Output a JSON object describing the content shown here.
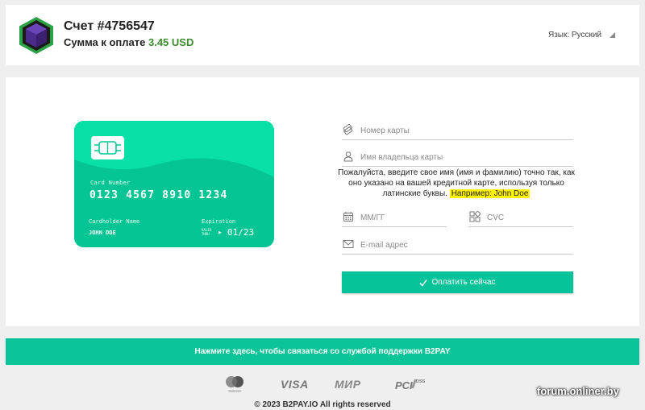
{
  "header": {
    "invoice_title": "Счет #4756547",
    "amount_label": "Сумма к оплате",
    "amount_value": "3.45 USD",
    "language": "Язык: Русский"
  },
  "card": {
    "number_label": "Card Number",
    "number": "0123 4567 8910 1234",
    "holder_label": "Cardholder Name",
    "holder_name": "JOHN DOE",
    "expiration_label": "Expiration",
    "valid_thru": "VALID THRU",
    "expiration": "01/23"
  },
  "form": {
    "card_number_placeholder": "Номер карты",
    "holder_placeholder": "Имя владельца карты",
    "hint_text": "Пожалуйста, введите свое имя (имя и фамилию) точно так, как оно указано на вашей кредитной карте, используя только латинские буквы.",
    "hint_example": "Например: John Doe",
    "expiry_placeholder": "ММ/ГГ",
    "cvc_placeholder": "CVC",
    "email_placeholder": "E-mail адрес",
    "pay_button": "Оплатить сейчас"
  },
  "support_text": "Нажмите здесь, чтобы связаться со службой поддержки B2PAY",
  "payment_logos": {
    "mastercard_caption": "mastercard",
    "visa": "VISA",
    "mir": "МИР",
    "pci": "PCI",
    "pci_sub": "DSS"
  },
  "copyright": "© 2023 B2PAY.IO All rights reserved",
  "watermark": "forum.onliner.by",
  "colors": {
    "accent": "#06c39a",
    "amount": "#3a8c2c",
    "highlight": "#fff200",
    "logo_purple": "#4b2c8a",
    "logo_green": "#2ca046"
  }
}
